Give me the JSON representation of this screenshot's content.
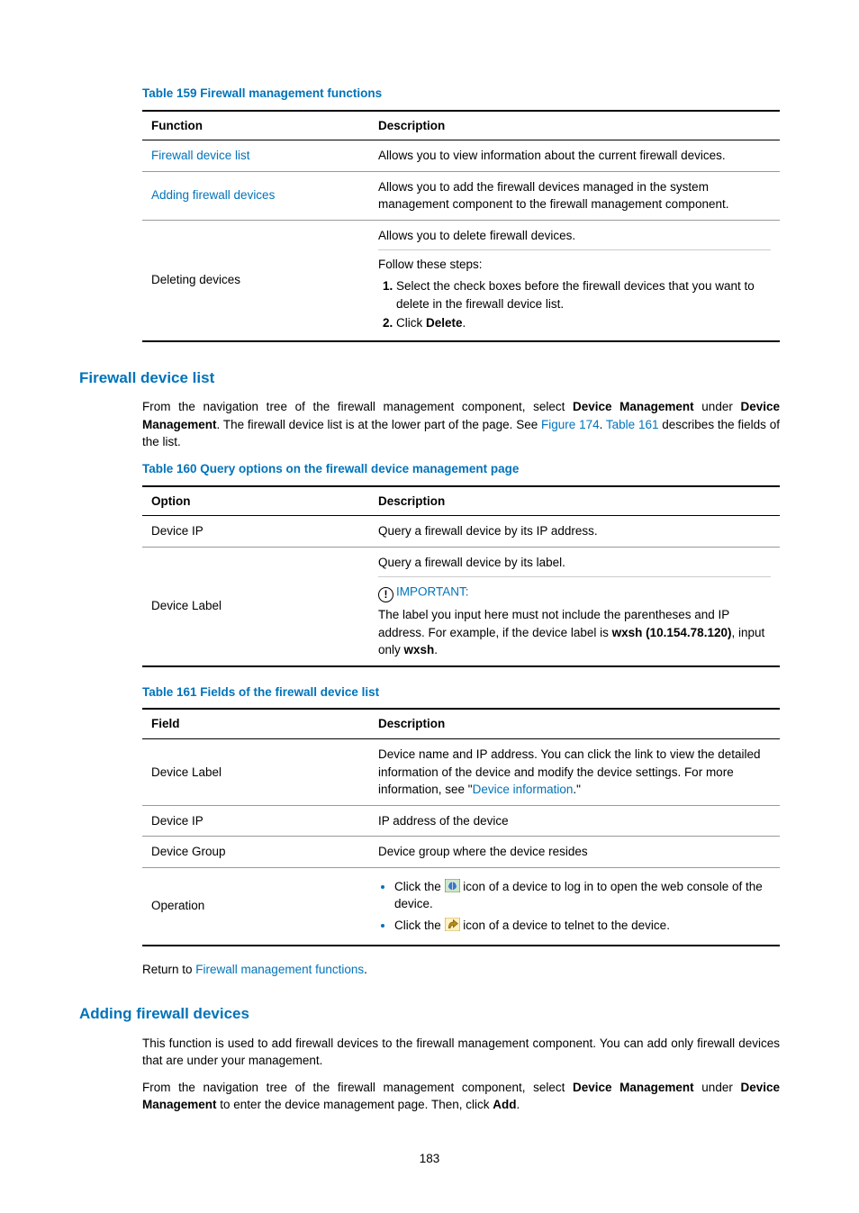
{
  "table159": {
    "caption": "Table 159 Firewall management functions",
    "headers": [
      "Function",
      "Description"
    ],
    "rows": [
      {
        "function_link": "Firewall device list",
        "description": "Allows you to view information about the current firewall devices."
      },
      {
        "function_link": "Adding firewall devices",
        "description": "Allows you to add the firewall devices managed in the system management component to the firewall management component."
      },
      {
        "function_plain": "Deleting devices",
        "description_intro": "Allows you to delete firewall devices.",
        "follow": "Follow these steps:",
        "step1": "Select the check boxes before the firewall devices that you want to delete in the firewall device list.",
        "step2_prefix": "Click ",
        "step2_bold": "Delete",
        "step2_suffix": "."
      }
    ]
  },
  "section_firewall_device_list": {
    "heading": "Firewall device list",
    "para_parts": {
      "p1": "From the navigation tree of the firewall management component, select ",
      "b1": "Device Management",
      "p2": " under ",
      "b2": "Device Management",
      "p3": ". The firewall device list is at the lower part of the page. See ",
      "link1": "Figure 174",
      "p4": ". ",
      "link2": "Table 161",
      "p5": " describes the fields of the list."
    }
  },
  "table160": {
    "caption": "Table 160 Query options on the firewall device management page",
    "headers": [
      "Option",
      "Description"
    ],
    "rows": [
      {
        "option": "Device IP",
        "description": "Query a firewall device by its IP address."
      },
      {
        "option": "Device Label",
        "desc_line1": "Query a firewall device by its label.",
        "important_label": "IMPORTANT:",
        "desc_line2_a": "The label you input here must not include the parentheses and IP address. For example, if the device label is ",
        "desc_line2_bold": "wxsh (10.154.78.120)",
        "desc_line2_b": ", input only ",
        "desc_line2_bold2": "wxsh",
        "desc_line2_c": "."
      }
    ]
  },
  "table161": {
    "caption": "Table 161 Fields of the firewall device list",
    "headers": [
      "Field",
      "Description"
    ],
    "rows": [
      {
        "field": "Device Label",
        "desc_a": "Device name and IP address. You can click the link to view the detailed information of the device and modify the device settings. For more information, see \"",
        "desc_link": "Device information",
        "desc_b": ".\""
      },
      {
        "field": "Device IP",
        "desc_plain": "IP address of the device"
      },
      {
        "field": "Device Group",
        "desc_plain": "Device group where the device resides"
      },
      {
        "field": "Operation",
        "bullet1_a": "Click the ",
        "bullet1_b": " icon of a device to log in to open the web console of the device.",
        "bullet2_a": "Click the ",
        "bullet2_b": " icon of a device to telnet to the device."
      }
    ]
  },
  "return_line": {
    "prefix": "Return to ",
    "link": "Firewall management functions",
    "suffix": "."
  },
  "section_adding": {
    "heading": "Adding firewall devices",
    "para1": "This function is used to add firewall devices to the firewall management component. You can add only firewall devices that are under your management.",
    "para2": {
      "a": "From the navigation tree of the firewall management component, select ",
      "b1": "Device Management",
      "b": " under ",
      "b2": "Device Management",
      "c": " to enter the device management page. Then, click ",
      "b3": "Add",
      "d": "."
    }
  },
  "page_number": "183"
}
